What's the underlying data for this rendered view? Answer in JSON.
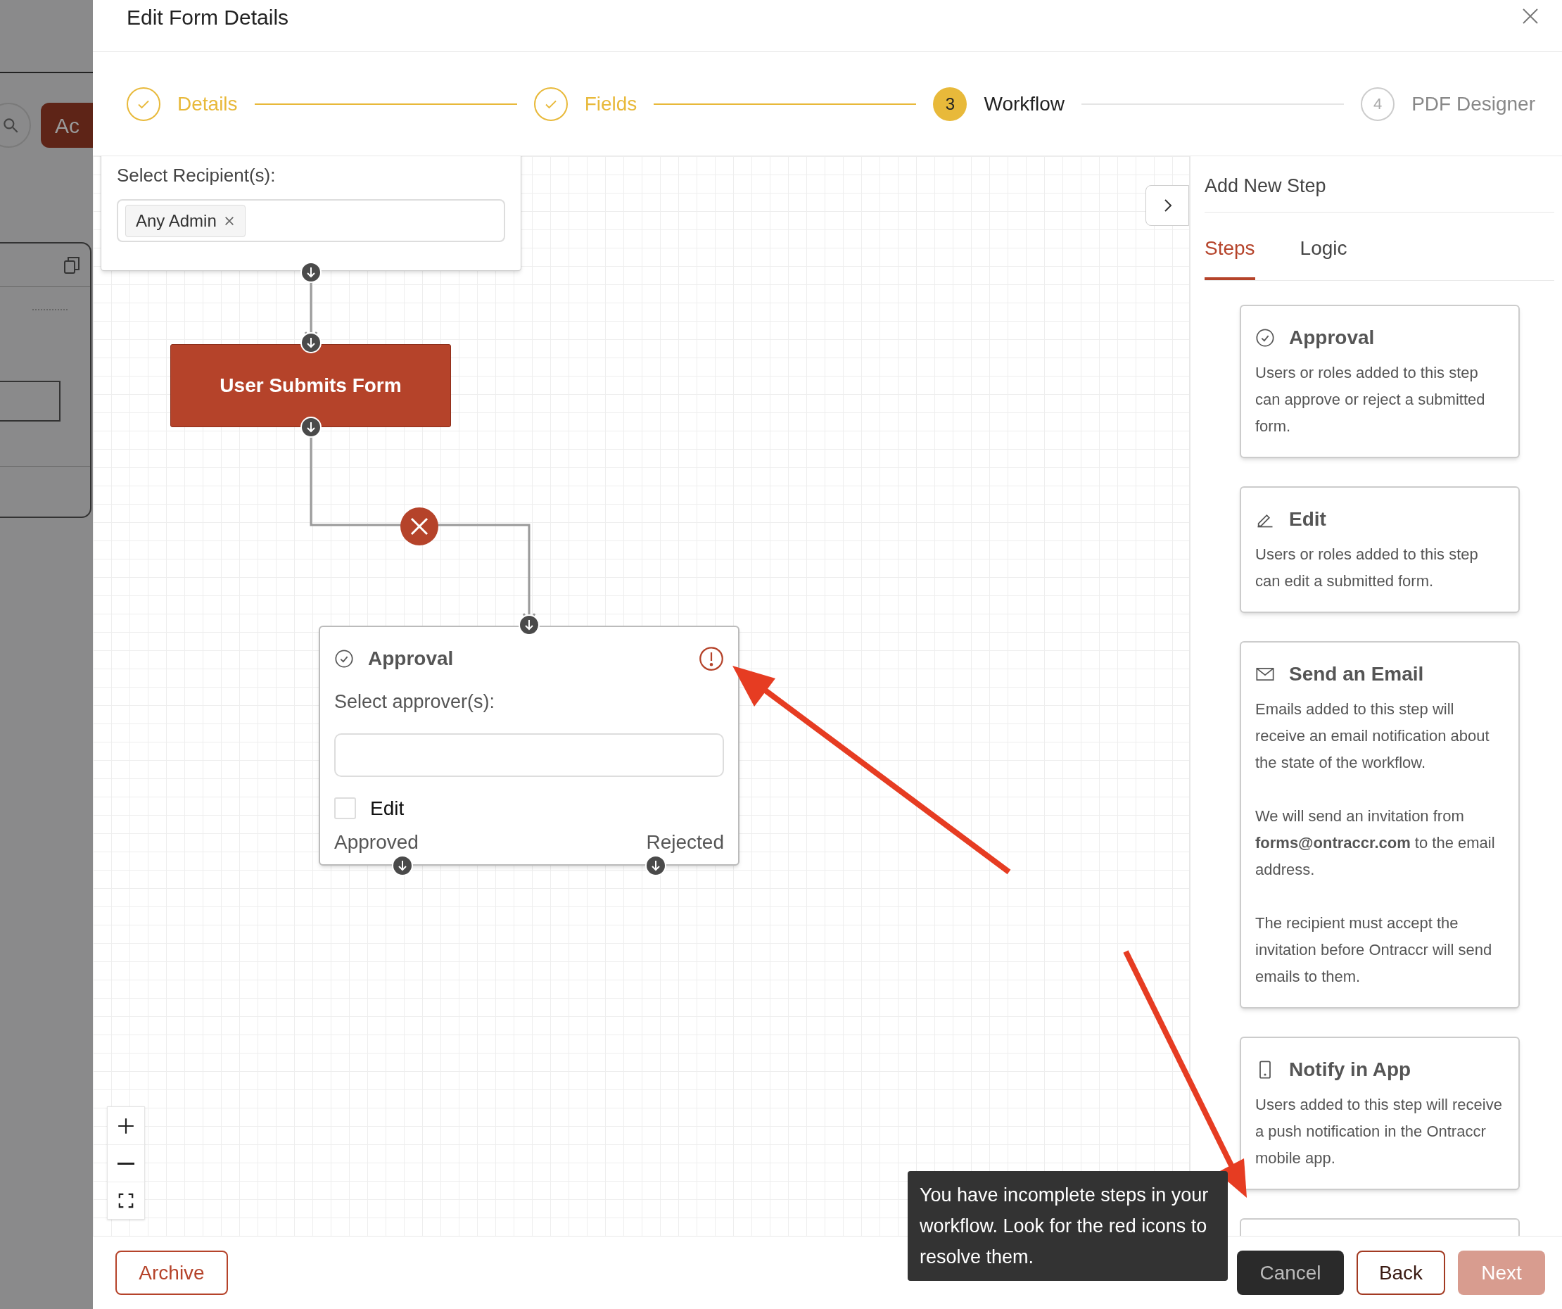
{
  "background_page": {
    "button_text": "Ac"
  },
  "dialog": {
    "title": "Edit Form Details"
  },
  "stepper": [
    {
      "label": "Details",
      "kind": "done"
    },
    {
      "label": "Fields",
      "kind": "done"
    },
    {
      "label": "Workflow",
      "kind": "current",
      "number": "3"
    },
    {
      "label": "PDF Designer",
      "kind": "upcoming",
      "number": "4"
    }
  ],
  "canvas": {
    "recipient_card": {
      "label": "Select Recipient(s):",
      "tags": [
        "Any Admin"
      ]
    },
    "trigger": {
      "label": "User Submits Form"
    },
    "approval_node": {
      "title": "Approval",
      "warning": true,
      "field_label": "Select approver(s):",
      "checkbox": {
        "label": "Edit",
        "checked": false
      },
      "outputs": [
        "Approved",
        "Rejected"
      ]
    }
  },
  "panel": {
    "title": "Add New Step",
    "tabs": [
      {
        "label": "Steps",
        "selected": true
      },
      {
        "label": "Logic",
        "selected": false
      }
    ],
    "steps": [
      {
        "kind": "approval",
        "title": "Approval",
        "paragraphs": [
          "Users or roles added to this step can approve or reject a submitted form."
        ]
      },
      {
        "kind": "edit",
        "title": "Edit",
        "paragraphs": [
          "Users or roles added to this step can edit a submitted form."
        ]
      },
      {
        "kind": "email",
        "title": "Send an Email",
        "paragraphs": [
          "Emails added to this step will receive an email notification about the state of the workflow.",
          "We will send an invitation from **forms@ontraccr.com** to the email address.",
          "The recipient must accept the invitation before Ontraccr will send emails to them."
        ]
      },
      {
        "kind": "app",
        "title": "Notify in App",
        "paragraphs": [
          "Users added to this step will receive a push notification in the Ontraccr mobile app."
        ]
      }
    ]
  },
  "footer": {
    "archive": "Archive",
    "buttons": [
      {
        "label": "Cancel",
        "kind": "secondary"
      },
      {
        "label": "Back",
        "kind": "outline"
      },
      {
        "label": "Next",
        "kind": "primary",
        "disabled": true
      }
    ]
  },
  "tooltip": {
    "text": "You have incomplete steps in your workflow. Look for the red icons to resolve them."
  }
}
